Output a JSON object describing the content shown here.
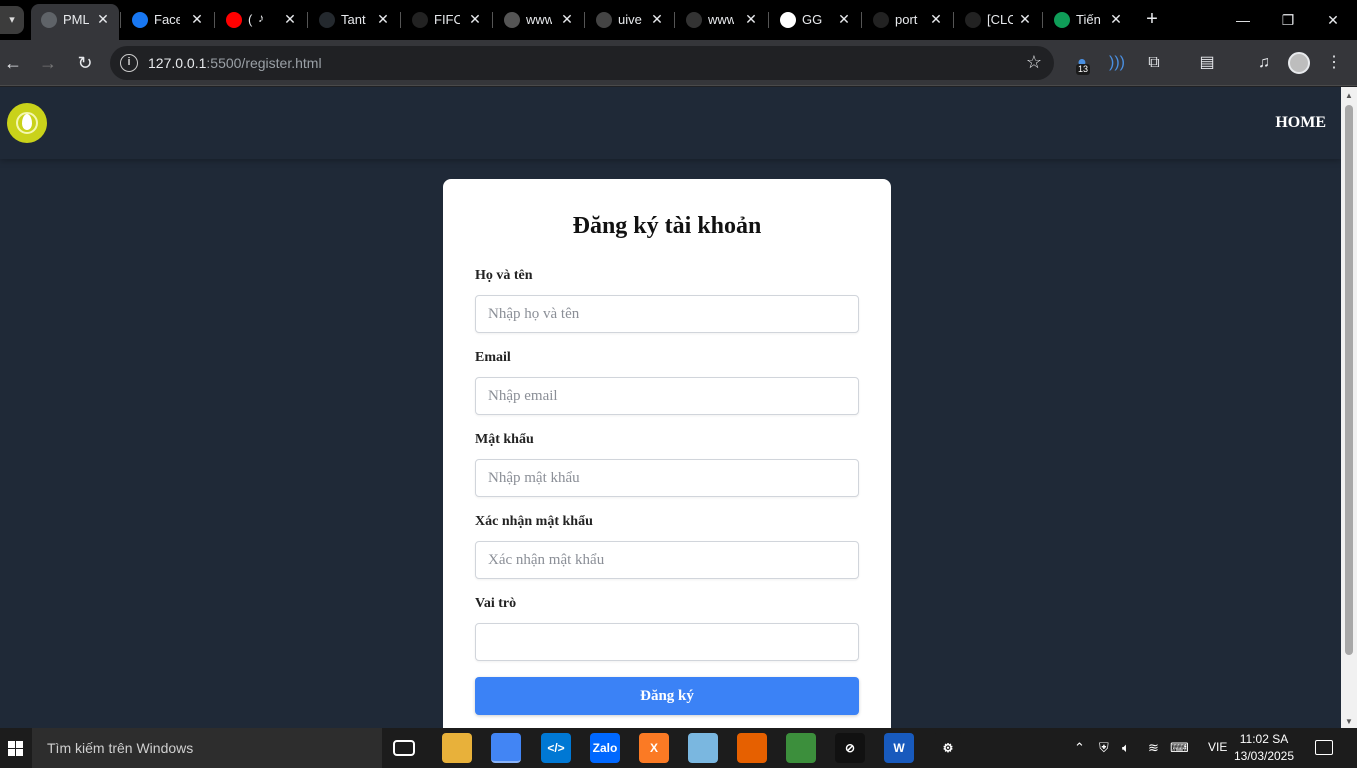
{
  "browser": {
    "tabs": [
      {
        "label": "PML",
        "icon": "globe-icon",
        "color": "#5f6368",
        "active": true
      },
      {
        "label": "Face",
        "icon": "facebook-icon",
        "color": "#1877f2"
      },
      {
        "label": "(",
        "icon": "youtube-icon",
        "color": "#ff0000",
        "audio": true
      },
      {
        "label": "Tant",
        "icon": "github-icon",
        "color": "#24292e"
      },
      {
        "label": "FIFC",
        "icon": "openai-icon",
        "color": "#222222"
      },
      {
        "label": "www",
        "icon": "bolt-icon",
        "color": "#555555"
      },
      {
        "label": "uive",
        "icon": "uiverse-icon",
        "color": "#444444"
      },
      {
        "label": "www",
        "icon": "dots-icon",
        "color": "#333333"
      },
      {
        "label": "GG",
        "icon": "google-icon",
        "color": "#ffffff"
      },
      {
        "label": "port",
        "icon": "building-icon",
        "color": "#222222"
      },
      {
        "label": "[CLC",
        "icon": "building-icon",
        "color": "#222222"
      },
      {
        "label": "Tiến",
        "icon": "sheets-icon",
        "color": "#0f9d58"
      }
    ],
    "url_host": "127.0.0.1",
    "url_rest": ":5500/register.html",
    "extension_badge": "13"
  },
  "page": {
    "nav_home": "HOME",
    "form_title": "Đăng ký tài khoản",
    "fields": [
      {
        "label": "Họ và tên",
        "placeholder": "Nhập họ và tên"
      },
      {
        "label": "Email",
        "placeholder": "Nhập email"
      },
      {
        "label": "Mật khẩu",
        "placeholder": "Nhập mật khẩu"
      },
      {
        "label": "Xác nhận mật khẩu",
        "placeholder": "Xác nhận mật khẩu"
      },
      {
        "label": "Vai trò",
        "placeholder": ""
      }
    ],
    "submit_label": "Đăng ký"
  },
  "taskbar": {
    "search_placeholder": "Tìm kiếm trên Windows",
    "language": "VIE",
    "time": "11:02 SA",
    "date": "13/03/2025",
    "apps": [
      {
        "name": "file-explorer-icon",
        "color": "#e8b13a",
        "text": ""
      },
      {
        "name": "chrome-icon",
        "color": "#4285f4",
        "text": ""
      },
      {
        "name": "vscode-icon",
        "color": "#0078d4",
        "text": "</>"
      },
      {
        "name": "zalo-icon",
        "color": "#0068ff",
        "text": "Zalo"
      },
      {
        "name": "xampp-icon",
        "color": "#fb7a24",
        "text": "X"
      },
      {
        "name": "notepad-icon",
        "color": "#7ab7e0",
        "text": ""
      },
      {
        "name": "firefox-icon",
        "color": "#e66000",
        "text": ""
      },
      {
        "name": "snipping-icon",
        "color": "#3c8f3c",
        "text": ""
      },
      {
        "name": "terminal-icon",
        "color": "#111111",
        "text": "⊘"
      },
      {
        "name": "word-icon",
        "color": "#185abd",
        "text": "W"
      },
      {
        "name": "settings-icon",
        "color": "#1c1c1c",
        "text": "⚙"
      }
    ]
  }
}
